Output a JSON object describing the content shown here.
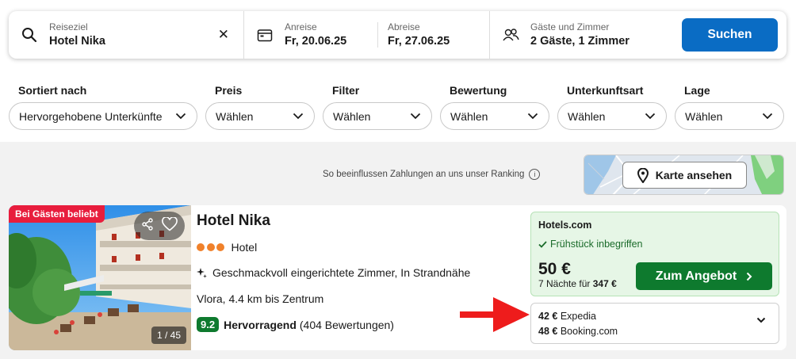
{
  "search": {
    "destination_label": "Reiseziel",
    "destination_value": "Hotel Nika",
    "clear_icon": "close-icon",
    "checkin_label": "Anreise",
    "checkin_value": "Fr, 20.06.25",
    "checkout_label": "Abreise",
    "checkout_value": "Fr, 27.06.25",
    "guests_label": "Gäste und Zimmer",
    "guests_value": "2 Gäste, 1 Zimmer",
    "search_button": "Suchen"
  },
  "filters": [
    {
      "label": "Sortiert nach",
      "value": "Hervorgehobene Unterkünfte"
    },
    {
      "label": "Preis",
      "value": "Wählen"
    },
    {
      "label": "Filter",
      "value": "Wählen"
    },
    {
      "label": "Bewertung",
      "value": "Wählen"
    },
    {
      "label": "Unterkunftsart",
      "value": "Wählen"
    },
    {
      "label": "Lage",
      "value": "Wählen"
    }
  ],
  "ranking_note": "So beeinflussen Zahlungen an uns unser Ranking",
  "map_button": "Karte ansehen",
  "hotel": {
    "badge": "Bei Gästen beliebt",
    "photo_counter": "1 / 45",
    "name": "Hotel Nika",
    "stars": 3,
    "type": "Hotel",
    "description": "Geschmackvoll eingerichtete Zimmer, In Strandnähe",
    "location": "Vlora, 4.4 km bis Zentrum",
    "score": "9.2",
    "rating_word": "Hervorragend",
    "reviews": "(404 Bewertungen)"
  },
  "offer": {
    "provider": "Hotels.com",
    "perk": "Frühstück inbegriffen",
    "price": "50 €",
    "nights_prefix": "7 Nächte für",
    "total": "347 €",
    "button": "Zum Angebot"
  },
  "alternatives": [
    {
      "price": "42 €",
      "provider": "Expedia"
    },
    {
      "price": "48 €",
      "provider": "Booking.com"
    }
  ],
  "colors": {
    "search_button": "#0a6cc4",
    "offer_button": "#0e7a2e",
    "badge": "#e81d3d",
    "arrow": "#ee1c1c",
    "star_dot": "#f0812b"
  }
}
